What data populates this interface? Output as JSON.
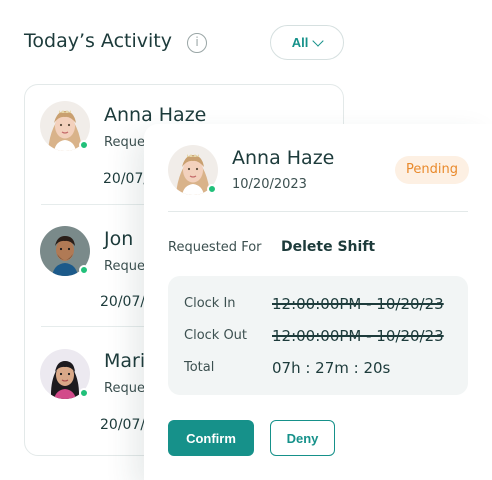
{
  "header": {
    "title": "Today’s Activity",
    "filter_label": "All"
  },
  "list": {
    "items": [
      {
        "name": "Anna Haze",
        "request": "Reque",
        "date": "20/07/",
        "online": true
      },
      {
        "name": "Jon",
        "request": "Reque",
        "date": "20/07/",
        "online": true
      },
      {
        "name": "Mari",
        "request": "Reque",
        "date": "20/07/",
        "online": true
      }
    ]
  },
  "detail": {
    "name": "Anna Haze",
    "date": "10/20/2023",
    "status": "Pending",
    "requested_for_label": "Requested For",
    "requested_for_value": "Delete Shift",
    "clock_in_label": "Clock In",
    "clock_in_value": "12:00:00PM - 10/20/23",
    "clock_out_label": "Clock Out",
    "clock_out_value": "12:00:00PM - 10/20/23",
    "total_label": "Total",
    "total_value": "07h : 27m : 20s",
    "confirm_label": "Confirm",
    "deny_label": "Deny"
  },
  "colors": {
    "accent": "#16918a",
    "pending_text": "#e98a2c",
    "pending_bg": "#fdf0e3",
    "online": "#21c07a"
  }
}
